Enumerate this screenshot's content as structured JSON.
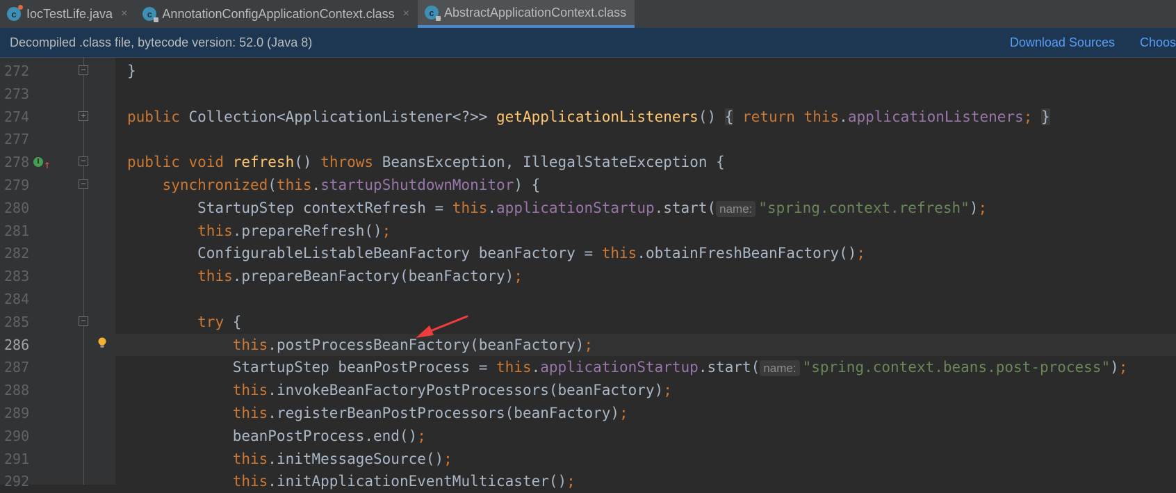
{
  "tabs": [
    {
      "label": "IocTestLife.java",
      "icon": "java-class-icon",
      "active": false
    },
    {
      "label": "AnnotationConfigApplicationContext.class",
      "icon": "locked-class-icon",
      "active": false
    },
    {
      "label": "AbstractApplicationContext.class",
      "icon": "locked-class-icon",
      "active": true
    }
  ],
  "close_glyph": "×",
  "infobar": {
    "message": "Decompiled .class file, bytecode version: 52.0 (Java 8)",
    "download_sources": "Download Sources",
    "choose_sources": "Choos"
  },
  "colors": {
    "keyword": "#cc7832",
    "method": "#ffc66d",
    "field": "#9876aa",
    "string": "#6a8759",
    "text": "#a9b7c6",
    "accent": "#4a88c7",
    "link": "#589df6",
    "annotation_arrow": "#f03c3c"
  },
  "editor": {
    "current_line": "286",
    "rows": [
      {
        "n": "272",
        "fold": "end",
        "tokens": [
          [
            "plain",
            "}"
          ]
        ]
      },
      {
        "n": "273",
        "tokens": []
      },
      {
        "n": "274",
        "fold": "collapsed",
        "tokens": [
          [
            "kw",
            "public "
          ],
          [
            "plain",
            "Collection<ApplicationListener<?>> "
          ],
          [
            "fn",
            "getApplicationListeners"
          ],
          [
            "plain",
            "() "
          ],
          [
            "fold",
            "{"
          ],
          [
            "plain",
            " "
          ],
          [
            "kw",
            "return "
          ],
          [
            "kw",
            "this"
          ],
          [
            "plain",
            "."
          ],
          [
            "field",
            "applicationListeners"
          ],
          [
            "kw",
            ";"
          ],
          [
            "plain",
            " "
          ],
          [
            "fold",
            "}"
          ]
        ]
      },
      {
        "n": "277",
        "tokens": []
      },
      {
        "n": "278",
        "fold": "start",
        "gutter": "implements-override-icon",
        "tokens": [
          [
            "kw",
            "public void "
          ],
          [
            "fn",
            "refresh"
          ],
          [
            "plain",
            "() "
          ],
          [
            "kw",
            "throws "
          ],
          [
            "plain",
            "BeansException, IllegalStateException {"
          ]
        ]
      },
      {
        "n": "279",
        "fold": "start",
        "tokens": [
          [
            "plain",
            "    "
          ],
          [
            "kw",
            "synchronized"
          ],
          [
            "plain",
            "("
          ],
          [
            "kw",
            "this"
          ],
          [
            "plain",
            "."
          ],
          [
            "field",
            "startupShutdownMonitor"
          ],
          [
            "plain",
            ") {"
          ]
        ]
      },
      {
        "n": "280",
        "tokens": [
          [
            "plain",
            "        StartupStep contextRefresh = "
          ],
          [
            "kw",
            "this"
          ],
          [
            "plain",
            "."
          ],
          [
            "field",
            "applicationStartup"
          ],
          [
            "plain",
            ".start("
          ],
          [
            "hint",
            "name:"
          ],
          [
            "str",
            "\"spring.context.refresh\""
          ],
          [
            "plain",
            ")"
          ],
          [
            "kw",
            ";"
          ]
        ]
      },
      {
        "n": "281",
        "tokens": [
          [
            "plain",
            "        "
          ],
          [
            "kw",
            "this"
          ],
          [
            "plain",
            ".prepareRefresh()"
          ],
          [
            "kw",
            ";"
          ]
        ]
      },
      {
        "n": "282",
        "tokens": [
          [
            "plain",
            "        ConfigurableListableBeanFactory beanFactory = "
          ],
          [
            "kw",
            "this"
          ],
          [
            "plain",
            ".obtainFreshBeanFactory()"
          ],
          [
            "kw",
            ";"
          ]
        ]
      },
      {
        "n": "283",
        "tokens": [
          [
            "plain",
            "        "
          ],
          [
            "kw",
            "this"
          ],
          [
            "plain",
            ".prepareBeanFactory(beanFactory)"
          ],
          [
            "kw",
            ";"
          ]
        ]
      },
      {
        "n": "284",
        "tokens": []
      },
      {
        "n": "285",
        "fold": "start",
        "tokens": [
          [
            "plain",
            "        "
          ],
          [
            "kw",
            "try "
          ],
          [
            "plain",
            "{"
          ]
        ]
      },
      {
        "n": "286",
        "gutter": "lightbulb-icon",
        "tokens": [
          [
            "plain",
            "            "
          ],
          [
            "kw",
            "this"
          ],
          [
            "plain",
            ".postProcessBeanFactory(beanFactory)"
          ],
          [
            "kw",
            ";"
          ]
        ]
      },
      {
        "n": "287",
        "tokens": [
          [
            "plain",
            "            StartupStep beanPostProcess = "
          ],
          [
            "kw",
            "this"
          ],
          [
            "plain",
            "."
          ],
          [
            "field",
            "applicationStartup"
          ],
          [
            "plain",
            ".start("
          ],
          [
            "hint",
            "name:"
          ],
          [
            "str",
            "\"spring.context.beans.post-process\""
          ],
          [
            "plain",
            ")"
          ],
          [
            "kw",
            ";"
          ]
        ]
      },
      {
        "n": "288",
        "tokens": [
          [
            "plain",
            "            "
          ],
          [
            "kw",
            "this"
          ],
          [
            "plain",
            ".invokeBeanFactoryPostProcessors(beanFactory)"
          ],
          [
            "kw",
            ";"
          ]
        ]
      },
      {
        "n": "289",
        "tokens": [
          [
            "plain",
            "            "
          ],
          [
            "kw",
            "this"
          ],
          [
            "plain",
            ".registerBeanPostProcessors(beanFactory)"
          ],
          [
            "kw",
            ";"
          ]
        ]
      },
      {
        "n": "290",
        "tokens": [
          [
            "plain",
            "            beanPostProcess.end()"
          ],
          [
            "kw",
            ";"
          ]
        ]
      },
      {
        "n": "291",
        "tokens": [
          [
            "plain",
            "            "
          ],
          [
            "kw",
            "this"
          ],
          [
            "plain",
            ".initMessageSource()"
          ],
          [
            "kw",
            ";"
          ]
        ]
      },
      {
        "n": "292",
        "tokens": [
          [
            "plain",
            "            "
          ],
          [
            "kw",
            "this"
          ],
          [
            "plain",
            ".initApplicationEventMulticaster()"
          ],
          [
            "kw",
            ";"
          ]
        ]
      }
    ]
  },
  "gutter_glyphs": {
    "implements": "I",
    "override_arrow": "↑"
  },
  "annotation": {
    "type": "red-arrow",
    "points_to": "postProcessBeanFactory"
  }
}
